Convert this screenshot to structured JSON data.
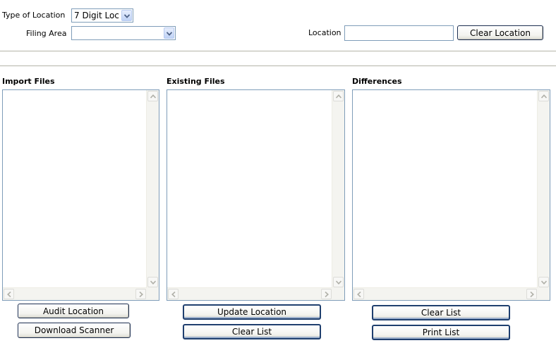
{
  "top": {
    "type_of_location_label": "Type of Location",
    "type_of_location_value": "7 Digit Loc",
    "filing_area_label": "Filing Area",
    "filing_area_value": "",
    "location_label": "Location",
    "location_value": "",
    "clear_location_label": "Clear Location"
  },
  "panels": {
    "import": {
      "title": "Import Files",
      "items": []
    },
    "existing": {
      "title": "Existing Files",
      "items": []
    },
    "differences": {
      "title": "Differences",
      "items": []
    }
  },
  "buttons": {
    "audit_location": "Audit Location",
    "download_scanner": "Download Scanner",
    "update_location": "Update Location",
    "clear_list_existing": "Clear List",
    "clear_list_differences": "Clear List",
    "print_list": "Print List"
  },
  "icons": {
    "dropdown": "chevron-down-icon",
    "scroll_up": "arrow-up-icon",
    "scroll_down": "arrow-down-icon",
    "scroll_left": "arrow-left-icon",
    "scroll_right": "arrow-right-icon"
  },
  "colors": {
    "field_border": "#7f9db9",
    "button_border": "#1c2e50",
    "divider": "#b4b4a8"
  }
}
